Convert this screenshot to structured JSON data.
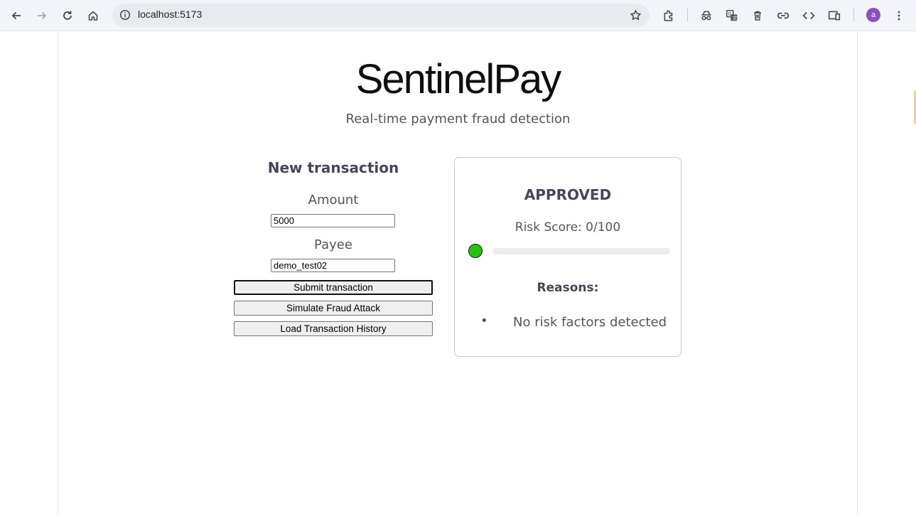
{
  "browser": {
    "url": "localhost:5173",
    "profile_initial": "a",
    "icons": [
      "back-icon",
      "forward-icon",
      "reload-icon",
      "home-icon",
      "site-info-icon",
      "bookmark-star-icon",
      "extensions-icon",
      "incognito-icon",
      "translate-icon",
      "trash-icon",
      "link-icon",
      "code-icon",
      "device-icon",
      "menu-icon"
    ]
  },
  "header": {
    "title": "SentinelPay",
    "subtitle": "Real-time payment fraud detection"
  },
  "form": {
    "heading": "New transaction",
    "amount_label": "Amount",
    "amount_value": "5000",
    "payee_label": "Payee",
    "payee_value": "demo_test02",
    "submit_label": "Submit transaction",
    "simulate_label": "Simulate Fraud Attack",
    "history_label": "Load Transaction History"
  },
  "result": {
    "status": "APPROVED",
    "risk_label": "Risk Score: 0/100",
    "risk_score": 0,
    "risk_max": 100,
    "indicator_color": "#22c311",
    "reasons_heading": "Reasons:",
    "reasons": [
      "No risk factors detected"
    ]
  }
}
